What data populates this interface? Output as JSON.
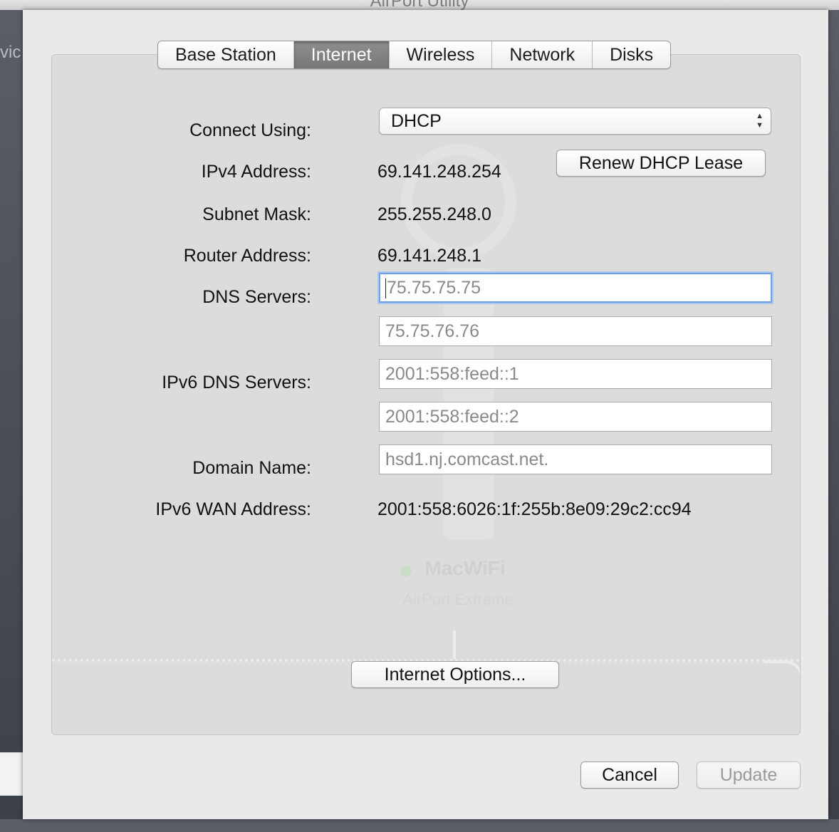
{
  "window": {
    "title": "AirPort Utility",
    "sidebar_fragment": "vic"
  },
  "tabs": [
    "Base Station",
    "Internet",
    "Wireless",
    "Network",
    "Disks"
  ],
  "active_tab": 1,
  "form": {
    "connect_label": "Connect Using:",
    "connect_value": "DHCP",
    "ipv4_label": "IPv4 Address:",
    "ipv4_value": "69.141.248.254",
    "renew_button": "Renew DHCP Lease",
    "subnet_label": "Subnet Mask:",
    "subnet_value": "255.255.248.0",
    "router_label": "Router Address:",
    "router_value": "69.141.248.1",
    "dns_label": "DNS Servers:",
    "dns1": "75.75.75.75",
    "dns2": "75.75.76.76",
    "ipv6dns_label": "IPv6 DNS Servers:",
    "ipv6dns1": "2001:558:feed::1",
    "ipv6dns2": "2001:558:feed::2",
    "domain_label": "Domain Name:",
    "domain_value": "hsd1.nj.comcast.net.",
    "ipv6wan_label": "IPv6 WAN Address:",
    "ipv6wan_value": "2001:558:6026:1f:255b:8e09:29c2:cc94"
  },
  "internet_options_button": "Internet Options...",
  "footer": {
    "cancel": "Cancel",
    "update": "Update"
  },
  "background": {
    "device_name": "MacWiFi",
    "device_model": "AirPort Extreme"
  },
  "colors": {
    "focus_ring": "#6fa3e0",
    "active_tab": "#808080"
  }
}
